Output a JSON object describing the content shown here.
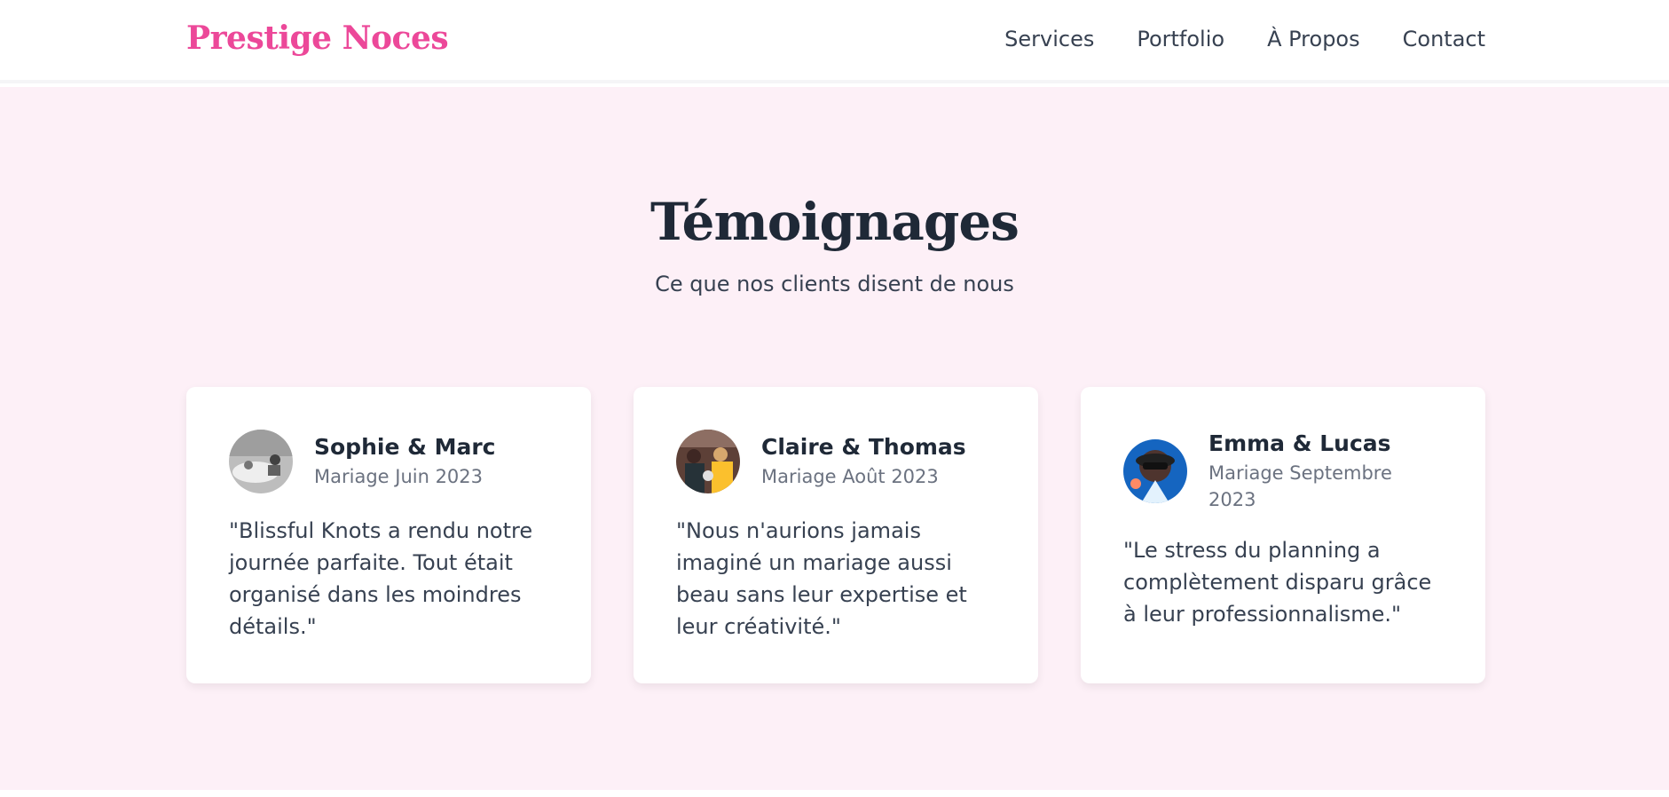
{
  "header": {
    "logo": "Prestige Noces",
    "nav": [
      "Services",
      "Portfolio",
      "À Propos",
      "Contact"
    ]
  },
  "section": {
    "title": "Témoignages",
    "subtitle": "Ce que nos clients disent de nous"
  },
  "testimonials": [
    {
      "name": "Sophie & Marc",
      "date": "Mariage Juin 2023",
      "quote": "\"Blissful Knots a rendu notre journée parfaite. Tout était organisé dans les moindres détails.\""
    },
    {
      "name": "Claire & Thomas",
      "date": "Mariage Août 2023",
      "quote": "\"Nous n'aurions jamais imaginé un mariage aussi beau sans leur expertise et leur créativité.\""
    },
    {
      "name": "Emma & Lucas",
      "date": "Mariage Septembre 2023",
      "quote": "\"Le stress du planning a complètement disparu grâce à leur professionnalisme.\""
    }
  ],
  "colors": {
    "brand": "#ec4899",
    "section_bg": "#fdf0f7",
    "text_dark": "#1f2937",
    "text_muted": "#6b7280"
  }
}
